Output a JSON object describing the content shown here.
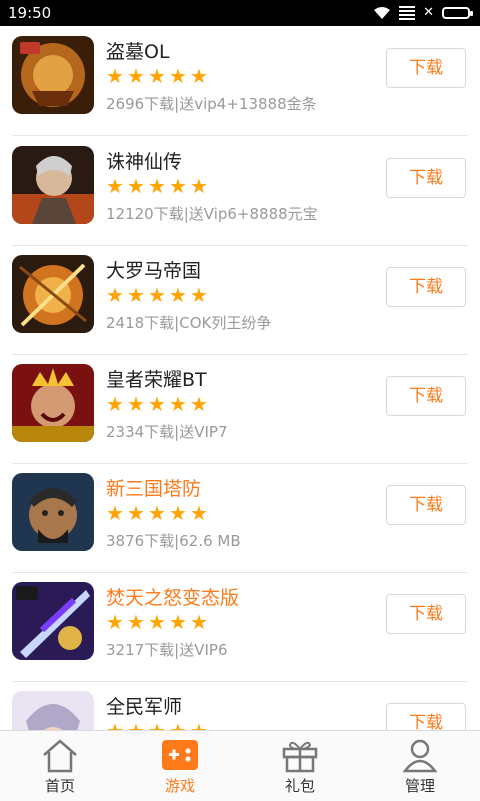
{
  "status_bar": {
    "time": "19:50"
  },
  "download_label": "下载",
  "colors": {
    "accent": "#ff7a1a",
    "star": "#ffa400"
  },
  "games": [
    {
      "name": "盗墓OL",
      "rating": 5,
      "info": "2696下载|送vip4+13888金条",
      "highlight": false,
      "icon": "daomu-game-icon"
    },
    {
      "name": "诛神仙传",
      "rating": 5,
      "info": "12120下载|送Vip6+8888元宝",
      "highlight": false,
      "icon": "zhushen-game-icon"
    },
    {
      "name": "大罗马帝国",
      "rating": 5,
      "info": "2418下载|COK列王纷争",
      "highlight": false,
      "icon": "roman-empire-game-icon"
    },
    {
      "name": "皇者荣耀BT",
      "rating": 5,
      "info": "2334下载|送VIP7",
      "highlight": false,
      "icon": "king-glory-game-icon"
    },
    {
      "name": "新三国塔防",
      "rating": 5,
      "info": "3876下载|62.6 MB",
      "highlight": true,
      "icon": "three-kingdoms-game-icon"
    },
    {
      "name": "焚天之怒变态版",
      "rating": 5,
      "info": "3217下载|送VIP6",
      "highlight": true,
      "icon": "fentian-game-icon"
    },
    {
      "name": "全民军师",
      "rating": 5,
      "info": "",
      "highlight": false,
      "icon": "strategist-game-icon"
    }
  ],
  "tabs": [
    {
      "label": "首页",
      "icon": "home-icon",
      "active": false
    },
    {
      "label": "游戏",
      "icon": "gamepad-icon",
      "active": true
    },
    {
      "label": "礼包",
      "icon": "gift-icon",
      "active": false
    },
    {
      "label": "管理",
      "icon": "user-icon",
      "active": false
    }
  ]
}
